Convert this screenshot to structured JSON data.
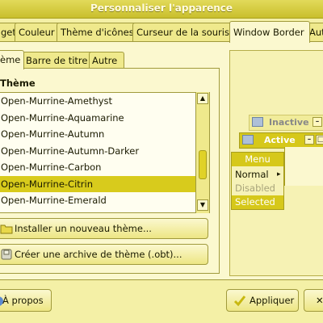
{
  "window": {
    "title": "Personnaliser l'apparence"
  },
  "main_tabs": [
    {
      "label": "get"
    },
    {
      "label": "Couleur"
    },
    {
      "label": "Thème d'icônes"
    },
    {
      "label": "Curseur de la souris"
    },
    {
      "label": "Window Border"
    },
    {
      "label": "Autr"
    }
  ],
  "sub_tabs": [
    {
      "label": "ème"
    },
    {
      "label": "Barre de titre"
    },
    {
      "label": "Autre"
    }
  ],
  "theme_list": {
    "header": "Thème",
    "items": [
      "Open-Murrine-Amethyst",
      "Open-Murrine-Aquamarine",
      "Open-Murrine-Autumn",
      "Open-Murrine-Autumn-Darker",
      "Open-Murrine-Carbon",
      "Open-Murrine-Citrin",
      "Open-Murrine-Emerald"
    ],
    "selected": "Open-Murrine-Citrin"
  },
  "actions": {
    "install_label": "Installer un nouveau thème...",
    "archive_label": "Créer une archive de thème (.obt)..."
  },
  "preview": {
    "inactive_label": "Inactive",
    "active_label": "Active",
    "menu": {
      "title": "Menu",
      "items": [
        "Normal",
        "Disabled",
        "Selected"
      ],
      "submenu_arrow": "▸"
    }
  },
  "footer": {
    "about_label": "À propos",
    "apply_label": "Appliquer"
  },
  "colors": {
    "accent": "#d6c81a",
    "background": "#f4f0a6"
  }
}
